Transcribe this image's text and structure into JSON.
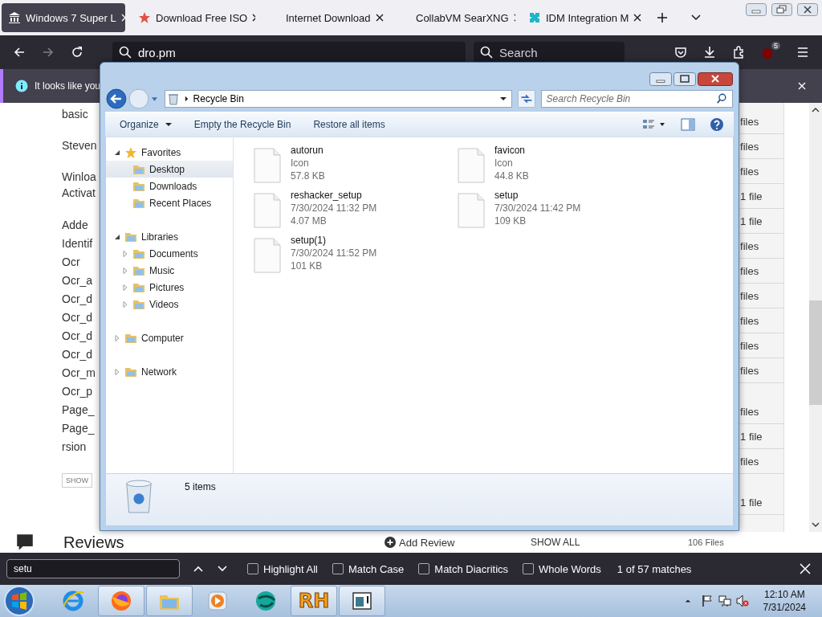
{
  "browser": {
    "tabs": [
      {
        "title": "Windows 7 Super L",
        "selected": true
      },
      {
        "title": "Download Free ISO",
        "selected": false
      },
      {
        "title": "Internet Download",
        "selected": false
      },
      {
        "title": "CollabVM SearXNG",
        "selected": false
      },
      {
        "title": "IDM Integration M",
        "selected": false
      }
    ],
    "toolbar": {
      "url": "dro.pm",
      "search_placeholder": "Search",
      "forward_disabled": true,
      "extension_badge": "5"
    },
    "notification": {
      "text": "It looks like you"
    }
  },
  "page": {
    "left_groups": [
      [
        "basic"
      ],
      [
        "Steven"
      ],
      [
        "Winloa",
        "Activat"
      ],
      [
        "Adde",
        "Identif",
        "Ocr",
        "Ocr_a",
        "Ocr_d",
        "Ocr_d",
        "Ocr_d",
        "Ocr_d",
        "Ocr_m",
        "Ocr_p",
        "Page_",
        "Page_",
        "rsion"
      ]
    ],
    "show_button": "SHOW",
    "right_groups": [
      [
        "files",
        "files",
        "files",
        "1 file",
        "1 file",
        "files",
        "files",
        "files",
        "files",
        "files",
        "files"
      ],
      [
        "files",
        "1 file",
        "files"
      ],
      [
        "1 file"
      ]
    ],
    "reviews_heading": "Reviews",
    "add_review": "Add Review",
    "show_all": "SHOW ALL",
    "files_total": "106 Files"
  },
  "explorer": {
    "address": "Recycle Bin",
    "search_placeholder": "Search Recycle Bin",
    "commands": [
      {
        "label": "Organize",
        "menu": true
      },
      {
        "label": "Empty the Recycle Bin",
        "menu": false
      },
      {
        "label": "Restore all items",
        "menu": false
      }
    ],
    "nav": [
      {
        "label": "Favorites",
        "expanded": true,
        "selected": false,
        "children": [
          {
            "label": "Desktop",
            "selected": true
          },
          {
            "label": "Downloads",
            "selected": false
          },
          {
            "label": "Recent Places",
            "selected": false
          }
        ]
      },
      {
        "label": "Libraries",
        "expanded": true,
        "selected": false,
        "children": [
          {
            "label": "Documents",
            "expanded": false,
            "selected": false
          },
          {
            "label": "Music",
            "expanded": false,
            "selected": false
          },
          {
            "label": "Pictures",
            "expanded": false,
            "selected": false
          },
          {
            "label": "Videos",
            "expanded": false,
            "selected": false
          }
        ]
      },
      {
        "label": "Computer",
        "expanded": false,
        "selected": false
      },
      {
        "label": "Network",
        "expanded": false,
        "selected": false
      }
    ],
    "files": [
      {
        "name": "autorun",
        "detail": "Icon",
        "size": "57.8 KB"
      },
      {
        "name": "favicon",
        "detail": "Icon",
        "size": "44.8 KB"
      },
      {
        "name": "reshacker_setup",
        "detail": "7/30/2024 11:32 PM",
        "size": "4.07 MB"
      },
      {
        "name": "setup",
        "detail": "7/30/2024 11:42 PM",
        "size": "109 KB"
      },
      {
        "name": "setup(1)",
        "detail": "7/30/2024 11:52 PM",
        "size": "101 KB"
      }
    ],
    "status": "5 items"
  },
  "find_bar": {
    "query": "setu",
    "options": [
      {
        "label": "Highlight All",
        "checked": false
      },
      {
        "label": "Match Case",
        "checked": false
      },
      {
        "label": "Match Diacritics",
        "checked": false
      },
      {
        "label": "Whole Words",
        "checked": false
      }
    ],
    "result": "1 of 57 matches"
  },
  "taskbar": {
    "apps": [
      {
        "kind": "ie",
        "running": false
      },
      {
        "kind": "firefox",
        "running": true
      },
      {
        "kind": "explorer",
        "running": true
      },
      {
        "kind": "media",
        "running": false
      },
      {
        "kind": "globe",
        "running": false
      },
      {
        "kind": "rh",
        "running": true,
        "label": "RH"
      },
      {
        "kind": "window",
        "running": true
      }
    ],
    "time": "12:10 AM",
    "date": "7/31/2024"
  }
}
